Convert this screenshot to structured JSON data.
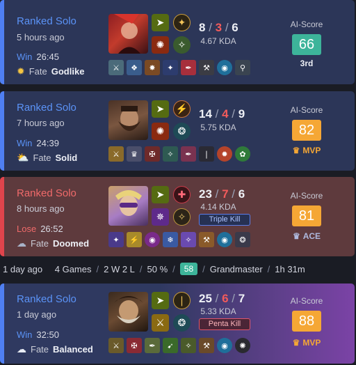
{
  "colors": {
    "win_accent": "#4f7ff2",
    "loss_accent": "#e0444c",
    "score_teal": "#3db49a",
    "score_orange": "#f5a735"
  },
  "matches": [
    {
      "mode": "Ranked Solo",
      "time_ago": "5 hours ago",
      "result": "Win",
      "duration": "26:45",
      "fate_prefix": "Fate",
      "fate": "Godlike",
      "fate_icon": "sun-icon",
      "kills": "8",
      "deaths": "3",
      "assists": "6",
      "kda_ratio": "4.67 KDA",
      "multikill": "",
      "ai_score_label": "AI-Score",
      "ai_score": "66",
      "badge": "3rd"
    },
    {
      "mode": "Ranked Solo",
      "time_ago": "7 hours ago",
      "result": "Win",
      "duration": "24:39",
      "fate_prefix": "Fate",
      "fate": "Solid",
      "fate_icon": "partly-cloudy-icon",
      "kills": "14",
      "deaths": "4",
      "assists": "9",
      "kda_ratio": "5.75 KDA",
      "multikill": "",
      "ai_score_label": "AI-Score",
      "ai_score": "82",
      "badge": "MVP"
    },
    {
      "mode": "Ranked Solo",
      "time_ago": "8 hours ago",
      "result": "Lose",
      "duration": "26:52",
      "fate_prefix": "Fate",
      "fate": "Doomed",
      "fate_icon": "storm-cloud-icon",
      "kills": "23",
      "deaths": "7",
      "assists": "6",
      "kda_ratio": "4.14 KDA",
      "multikill": "Triple Kill",
      "ai_score_label": "AI-Score",
      "ai_score": "81",
      "badge": "ACE"
    },
    {
      "mode": "Ranked Solo",
      "time_ago": "1 day ago",
      "result": "Win",
      "duration": "32:50",
      "fate_prefix": "Fate",
      "fate": "Balanced",
      "fate_icon": "cloud-icon",
      "kills": "25",
      "deaths": "6",
      "assists": "7",
      "kda_ratio": "5.33 KDA",
      "multikill": "Penta Kill",
      "ai_score_label": "AI-Score",
      "ai_score": "88",
      "badge": "MVP"
    }
  ],
  "summary": {
    "period": "1 day ago",
    "games": "4 Games",
    "record": "2 W 2 L",
    "winrate": "50 %",
    "lp": "58",
    "rank": "Grandmaster",
    "playtime": "1h 31m"
  }
}
